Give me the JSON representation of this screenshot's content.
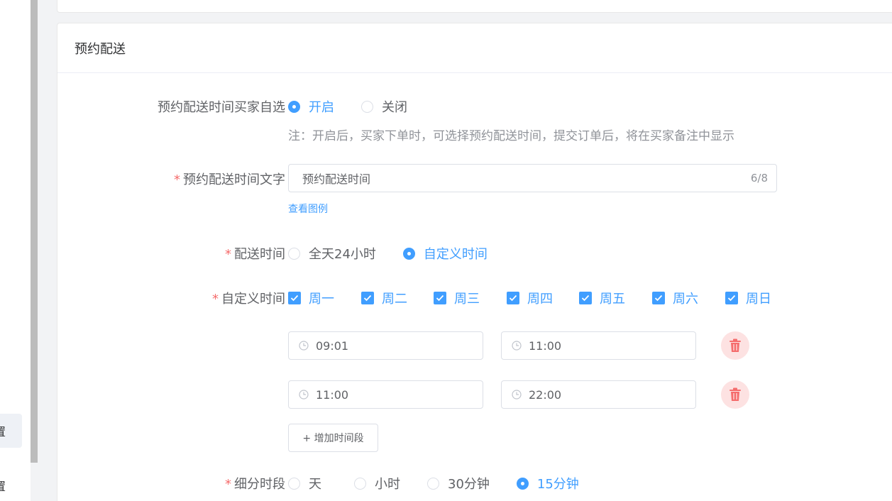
{
  "nav": {
    "item1": "置",
    "item2": "置"
  },
  "section": {
    "title": "预约配送"
  },
  "buyer_select": {
    "label": "预约配送时间买家自选",
    "options": [
      {
        "label": "开启",
        "selected": true
      },
      {
        "label": "关闭",
        "selected": false
      }
    ],
    "note": "注：开启后，买家下单时，可选择预约配送时间，提交订单后，将在买家备注中显示"
  },
  "time_text": {
    "required_mark": "*",
    "label": "预约配送时间文字",
    "value": "预约配送时间",
    "counter": "6/8",
    "example_link": "查看图例"
  },
  "delivery_time": {
    "required_mark": "*",
    "label": "配送时间",
    "options": [
      {
        "label": "全天24小时",
        "selected": false
      },
      {
        "label": "自定义时间",
        "selected": true
      }
    ]
  },
  "custom_time": {
    "required_mark": "*",
    "label": "自定义时间",
    "days": [
      {
        "label": "周一",
        "checked": true
      },
      {
        "label": "周二",
        "checked": true
      },
      {
        "label": "周三",
        "checked": true
      },
      {
        "label": "周四",
        "checked": true
      },
      {
        "label": "周五",
        "checked": true
      },
      {
        "label": "周六",
        "checked": true
      },
      {
        "label": "周日",
        "checked": true
      }
    ],
    "slots": [
      {
        "start": "09:01",
        "end": "11:00"
      },
      {
        "start": "11:00",
        "end": "22:00"
      }
    ],
    "add_button": "+ 增加时间段"
  },
  "subdivision": {
    "required_mark": "*",
    "label": "细分时段",
    "options": [
      {
        "label": "天",
        "selected": false
      },
      {
        "label": "小时",
        "selected": false
      },
      {
        "label": "30分钟",
        "selected": false
      },
      {
        "label": "15分钟",
        "selected": true
      }
    ]
  },
  "colors": {
    "primary": "#409eff",
    "danger": "#f56c6c",
    "danger_light": "#fde2e2"
  },
  "icons": [
    "clock-icon",
    "trash-icon",
    "check-icon"
  ]
}
